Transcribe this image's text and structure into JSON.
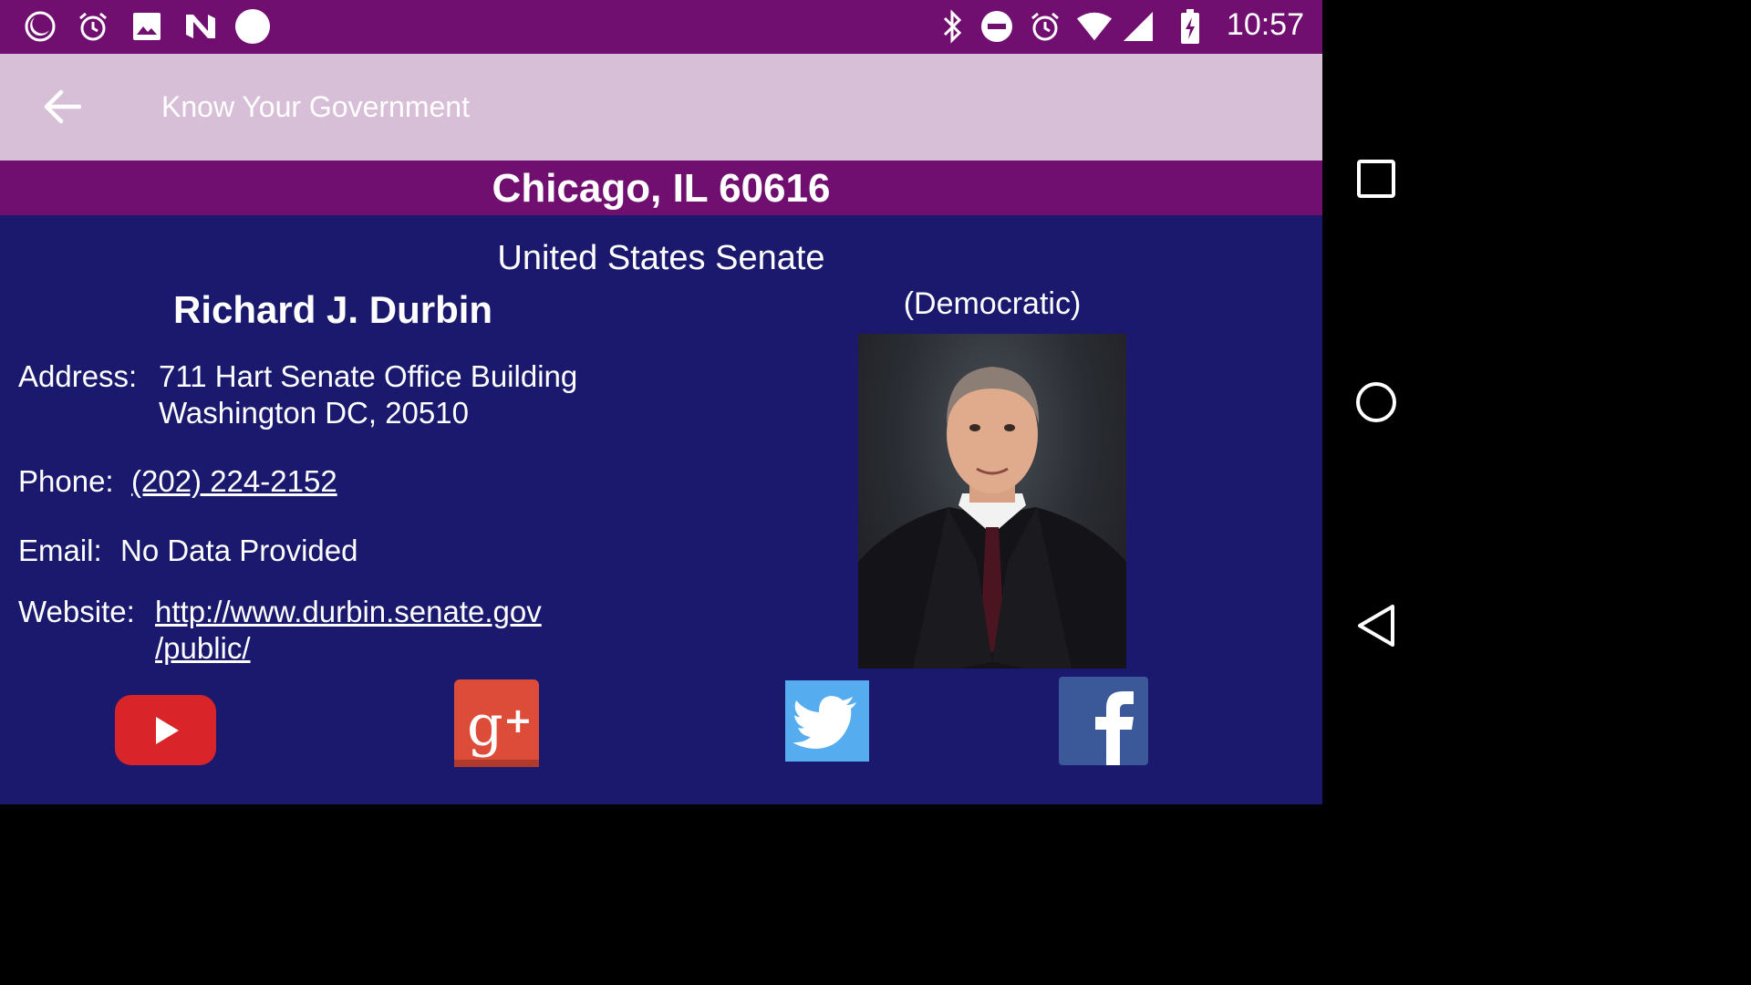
{
  "status_bar": {
    "time": "10:57",
    "left_icons": [
      "moon-icon",
      "alarm-icon",
      "image-icon",
      "n-logo-icon",
      "circle-icon"
    ],
    "right_icons": [
      "bluetooth-icon",
      "do-not-disturb-icon",
      "alarm-icon",
      "wifi-icon",
      "signal-icon",
      "battery-charging-icon"
    ],
    "color": "#700f6f"
  },
  "app_bar": {
    "title": "Know Your Government",
    "back_icon": "arrow-back-icon",
    "color": "#d8bfd8"
  },
  "location": {
    "text": "Chicago, IL 60616"
  },
  "official": {
    "chamber": "United States Senate",
    "name": "Richard J. Durbin",
    "party": "(Democratic)",
    "address_label": "Address:",
    "address_line1": "711 Hart Senate Office Building",
    "address_line2": "Washington DC, 20510",
    "phone_label": "Phone:",
    "phone": "(202) 224-2152",
    "email_label": "Email:",
    "email": "No Data Provided",
    "website_label": "Website:",
    "website_line1": "http://www.durbin.senate.gov",
    "website_line2": "/public/"
  },
  "social": [
    "youtube-icon",
    "google-plus-icon",
    "twitter-icon",
    "facebook-icon"
  ],
  "nav_bar": [
    "recents-square-icon",
    "home-circle-icon",
    "back-triangle-icon"
  ],
  "colors": {
    "background": "#1a196e",
    "youtube": "#d9252a",
    "google_plus": "#dd4b39",
    "twitter": "#55acee",
    "facebook": "#3b5998"
  }
}
